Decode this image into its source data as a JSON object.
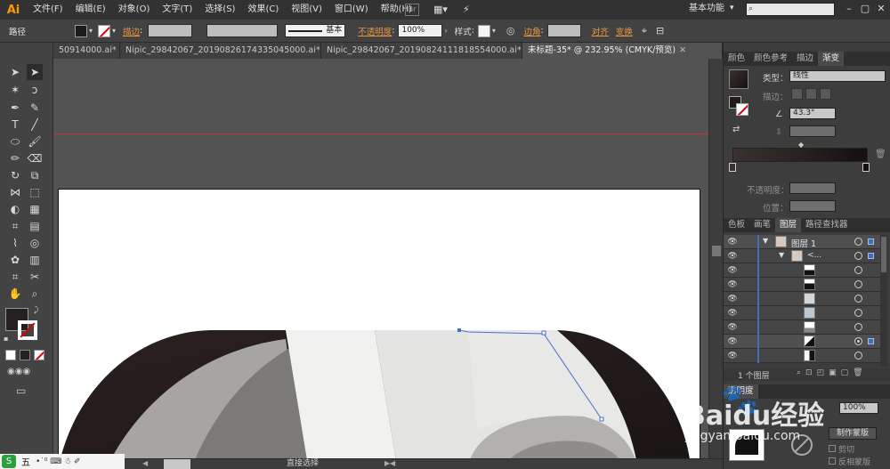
{
  "app": {
    "logo": "Ai"
  },
  "menu": [
    "文件(F)",
    "编辑(E)",
    "对象(O)",
    "文字(T)",
    "选择(S)",
    "效果(C)",
    "视图(V)",
    "窗口(W)",
    "帮助(H)"
  ],
  "menubar_right": {
    "br_label": "Br",
    "workspace": "基本功能"
  },
  "control": {
    "selection_label": "路径",
    "stroke_label": "描边",
    "stroke_colon": ":",
    "stroke_style": "基本",
    "opacity_label": "不透明度",
    "opacity_colon": ":",
    "opacity_value": "100%",
    "style_label": "样式",
    "style_colon": ":",
    "corner_label": "边角",
    "corner_colon": ":",
    "align_label": "对齐",
    "transform_label": "变换"
  },
  "tabs": [
    {
      "label": "50914000.ai*",
      "active": false
    },
    {
      "label": "Nipic_29842067_20190826174335045000.ai*",
      "active": false
    },
    {
      "label": "Nipic_29842067_20190824111818554000.ai*",
      "active": false
    },
    {
      "label": "未标题-35* @ 232.95% (CMYK/预览)",
      "active": true
    }
  ],
  "color_panel": {
    "tabs": [
      "颜色",
      "颜色参考",
      "描边",
      "渐变"
    ],
    "type_label": "类型：",
    "type_value": "线性",
    "stroke_label": "描边：",
    "angle_value": "43.3°",
    "opacity_label": "不透明度：",
    "position_label": "位置："
  },
  "layers_panel": {
    "tabs": [
      "色板",
      "画笔",
      "图层",
      "路径查找器"
    ],
    "layer_name": "图层 1",
    "group_name": "<...",
    "footer": "1 个图层"
  },
  "bottom_panel": {
    "tab": "透明度",
    "opacity_value": "100%",
    "make_mask": "制作蒙版",
    "clip": "剪切",
    "invert_mask": "反相蒙版"
  },
  "status": {
    "tool_name": "直接选择"
  },
  "taskbar": {
    "ime": "五"
  },
  "watermark": {
    "brand": "Baidu经验",
    "url": "jingyan.baidu.com"
  },
  "colors": {
    "accent_orange": "#e8953a",
    "layer_blue": "#3f6fb7",
    "guide_red": "#c0392b",
    "gradient_dark": "#2a2120"
  }
}
